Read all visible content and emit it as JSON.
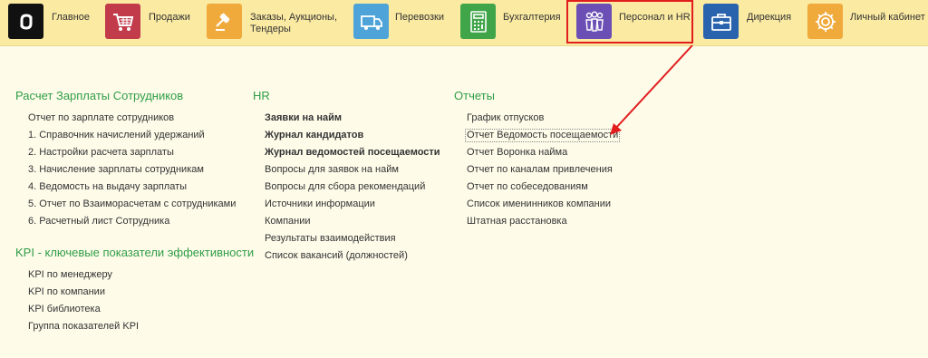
{
  "nav": {
    "items": [
      {
        "label": "Главное",
        "icon": "logo-icon",
        "color": "#111111"
      },
      {
        "label": "Продажи",
        "icon": "cart-icon",
        "color": "#c23b4b"
      },
      {
        "label": "Заказы,  Аукционы,",
        "label2": "Тендеры",
        "icon": "gavel-icon",
        "color": "#f0a93b"
      },
      {
        "label": "Перевозки",
        "icon": "truck-icon",
        "color": "#4ea4d8"
      },
      {
        "label": "Бухгалтерия",
        "icon": "calculator-icon",
        "color": "#3fa548"
      },
      {
        "label": "Персонал и HR",
        "icon": "people-icon",
        "color": "#6c4fb5"
      },
      {
        "label": "Дирекция",
        "icon": "briefcase-icon",
        "color": "#2a63ad"
      },
      {
        "label": "Личный кабинет",
        "icon": "gear-icon",
        "color": "#f0a93b"
      }
    ]
  },
  "sections": {
    "payroll": {
      "title": "Расчет Зарплаты Сотрудников",
      "items": [
        "Отчет по зарплате сотрудников",
        "1. Справочник начислений удержаний",
        "2. Настройки расчета зарплаты",
        "3. Начисление зарплаты сотрудникам",
        "4. Ведомость на выдачу зарплаты",
        "5. Отчет по Взаиморасчетам с сотрудниками",
        "6. Расчетный лист Сотрудника"
      ]
    },
    "kpi": {
      "title": "KPI - ключевые показатели эффективности",
      "items": [
        "KPI по менеджеру",
        "KPI по компании",
        "KPI библиотека",
        "Группа показателей KPI"
      ]
    },
    "hr": {
      "title": "HR",
      "items": [
        "Заявки на найм",
        "Журнал кандидатов",
        "Журнал ведомостей посещаемости",
        "Вопросы для заявок на найм",
        "Вопросы для сбора рекомендаций",
        "Источники информации",
        "Компании",
        "Результаты взаимодействия",
        "Список вакансий (должностей)"
      ]
    },
    "reports": {
      "title": "Отчеты",
      "items": [
        "График отпусков",
        "Отчет Ведомость посещаемости",
        "Отчет Воронка найма",
        "Отчет по каналам привлечения",
        "Отчет по собеседованиям",
        "Список именинников компании",
        "Штатная расстановка"
      ]
    }
  },
  "colors": {
    "accent_green": "#2f9e47",
    "highlight_red": "#e11d1d",
    "topbar": "#fbeaa2",
    "page": "#fefbe9"
  }
}
